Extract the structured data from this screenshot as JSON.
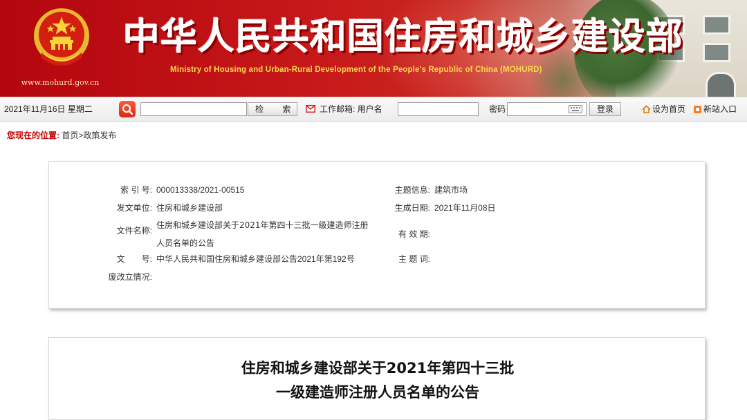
{
  "banner": {
    "title_cn": "中华人民共和国住房和城乡建设部",
    "title_en": "Ministry of Housing and Urban-Rural Development of the People's Republic of China (MOHURD)",
    "url": "www.mohurd.gov.cn"
  },
  "toolbar": {
    "date": "2021年11月16日 星期二",
    "search_value": "",
    "search_button": "检 索",
    "mail_label": "工作邮箱: 用户名",
    "username_value": "",
    "password_label": "密码",
    "password_value": "",
    "login_button": "登录",
    "set_home": "设为首页",
    "new_site": "新站入口"
  },
  "breadcrumb": {
    "label": "您现在的位置:",
    "path": "首页>政策发布"
  },
  "info": {
    "index_label": "索 引 号:",
    "index_value": "000013338/2021-00515",
    "issuer_label": "发文单位:",
    "issuer_value": "住房和城乡建设部",
    "filename_label": "文件名称:",
    "filename_line1": "住房和城乡建设部关于2021年第四十三批一级建造师注册",
    "filename_line2": "人员名单的公告",
    "docno_label": "文　　号:",
    "docno_value": "中华人民共和国住房和城乡建设部公告2021年第192号",
    "status_label": "废改立情况:",
    "status_value": "",
    "topic_label": "主题信息:",
    "topic_value": "建筑市场",
    "date_label": "生成日期:",
    "date_value": "2021年11月08日",
    "validity_label": "有 效 期:",
    "validity_value": "",
    "keywords_label": "主 题 词:",
    "keywords_value": ""
  },
  "article": {
    "title_line1": "住房和城乡建设部关于2021年第四十三批",
    "title_line2": "一级建造师注册人员名单的公告"
  },
  "icons": {
    "search": "search-icon",
    "mail": "mail-icon",
    "keyboard": "keyboard-icon",
    "home": "home-icon",
    "new_site": "new-site-icon",
    "emblem": "national-emblem-icon"
  },
  "colors": {
    "banner_red": "#c81a1a",
    "title_en_yellow": "#ffd84a",
    "breadcrumb_red": "#c40000",
    "search_button_red": "#d92a12"
  }
}
